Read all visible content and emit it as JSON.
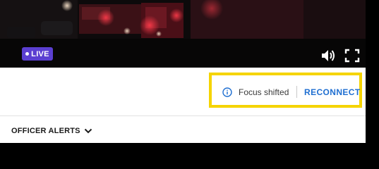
{
  "player": {
    "live_label": "LIVE",
    "volume_icon": "volume-icon",
    "fullscreen_icon": "fullscreen-icon"
  },
  "notice": {
    "icon": "info-icon",
    "message": "Focus shifted",
    "action_label": "RECONNECT",
    "highlight_color": "#f5d400",
    "action_color": "#1f6fd1"
  },
  "alerts": {
    "label": "OFFICER ALERTS",
    "icon": "chevron-down-icon"
  },
  "colors": {
    "live_badge": "#5b3fd1"
  }
}
